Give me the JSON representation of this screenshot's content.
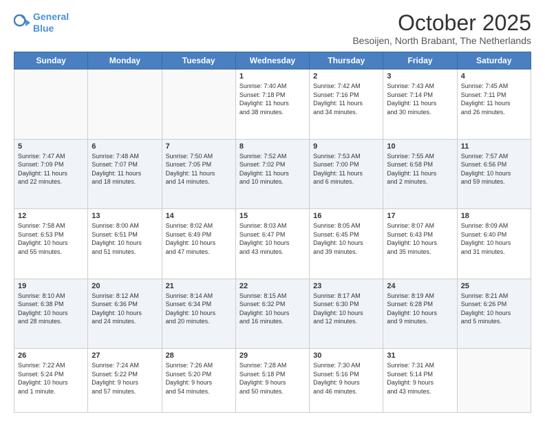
{
  "logo": {
    "line1": "General",
    "line2": "Blue"
  },
  "header": {
    "month": "October 2025",
    "location": "Besoijen, North Brabant, The Netherlands"
  },
  "weekdays": [
    "Sunday",
    "Monday",
    "Tuesday",
    "Wednesday",
    "Thursday",
    "Friday",
    "Saturday"
  ],
  "weeks": [
    [
      {
        "day": "",
        "info": ""
      },
      {
        "day": "",
        "info": ""
      },
      {
        "day": "",
        "info": ""
      },
      {
        "day": "1",
        "info": "Sunrise: 7:40 AM\nSunset: 7:18 PM\nDaylight: 11 hours\nand 38 minutes."
      },
      {
        "day": "2",
        "info": "Sunrise: 7:42 AM\nSunset: 7:16 PM\nDaylight: 11 hours\nand 34 minutes."
      },
      {
        "day": "3",
        "info": "Sunrise: 7:43 AM\nSunset: 7:14 PM\nDaylight: 11 hours\nand 30 minutes."
      },
      {
        "day": "4",
        "info": "Sunrise: 7:45 AM\nSunset: 7:11 PM\nDaylight: 11 hours\nand 26 minutes."
      }
    ],
    [
      {
        "day": "5",
        "info": "Sunrise: 7:47 AM\nSunset: 7:09 PM\nDaylight: 11 hours\nand 22 minutes."
      },
      {
        "day": "6",
        "info": "Sunrise: 7:48 AM\nSunset: 7:07 PM\nDaylight: 11 hours\nand 18 minutes."
      },
      {
        "day": "7",
        "info": "Sunrise: 7:50 AM\nSunset: 7:05 PM\nDaylight: 11 hours\nand 14 minutes."
      },
      {
        "day": "8",
        "info": "Sunrise: 7:52 AM\nSunset: 7:02 PM\nDaylight: 11 hours\nand 10 minutes."
      },
      {
        "day": "9",
        "info": "Sunrise: 7:53 AM\nSunset: 7:00 PM\nDaylight: 11 hours\nand 6 minutes."
      },
      {
        "day": "10",
        "info": "Sunrise: 7:55 AM\nSunset: 6:58 PM\nDaylight: 11 hours\nand 2 minutes."
      },
      {
        "day": "11",
        "info": "Sunrise: 7:57 AM\nSunset: 6:56 PM\nDaylight: 10 hours\nand 59 minutes."
      }
    ],
    [
      {
        "day": "12",
        "info": "Sunrise: 7:58 AM\nSunset: 6:53 PM\nDaylight: 10 hours\nand 55 minutes."
      },
      {
        "day": "13",
        "info": "Sunrise: 8:00 AM\nSunset: 6:51 PM\nDaylight: 10 hours\nand 51 minutes."
      },
      {
        "day": "14",
        "info": "Sunrise: 8:02 AM\nSunset: 6:49 PM\nDaylight: 10 hours\nand 47 minutes."
      },
      {
        "day": "15",
        "info": "Sunrise: 8:03 AM\nSunset: 6:47 PM\nDaylight: 10 hours\nand 43 minutes."
      },
      {
        "day": "16",
        "info": "Sunrise: 8:05 AM\nSunset: 6:45 PM\nDaylight: 10 hours\nand 39 minutes."
      },
      {
        "day": "17",
        "info": "Sunrise: 8:07 AM\nSunset: 6:43 PM\nDaylight: 10 hours\nand 35 minutes."
      },
      {
        "day": "18",
        "info": "Sunrise: 8:09 AM\nSunset: 6:40 PM\nDaylight: 10 hours\nand 31 minutes."
      }
    ],
    [
      {
        "day": "19",
        "info": "Sunrise: 8:10 AM\nSunset: 6:38 PM\nDaylight: 10 hours\nand 28 minutes."
      },
      {
        "day": "20",
        "info": "Sunrise: 8:12 AM\nSunset: 6:36 PM\nDaylight: 10 hours\nand 24 minutes."
      },
      {
        "day": "21",
        "info": "Sunrise: 8:14 AM\nSunset: 6:34 PM\nDaylight: 10 hours\nand 20 minutes."
      },
      {
        "day": "22",
        "info": "Sunrise: 8:15 AM\nSunset: 6:32 PM\nDaylight: 10 hours\nand 16 minutes."
      },
      {
        "day": "23",
        "info": "Sunrise: 8:17 AM\nSunset: 6:30 PM\nDaylight: 10 hours\nand 12 minutes."
      },
      {
        "day": "24",
        "info": "Sunrise: 8:19 AM\nSunset: 6:28 PM\nDaylight: 10 hours\nand 9 minutes."
      },
      {
        "day": "25",
        "info": "Sunrise: 8:21 AM\nSunset: 6:26 PM\nDaylight: 10 hours\nand 5 minutes."
      }
    ],
    [
      {
        "day": "26",
        "info": "Sunrise: 7:22 AM\nSunset: 5:24 PM\nDaylight: 10 hours\nand 1 minute."
      },
      {
        "day": "27",
        "info": "Sunrise: 7:24 AM\nSunset: 5:22 PM\nDaylight: 9 hours\nand 57 minutes."
      },
      {
        "day": "28",
        "info": "Sunrise: 7:26 AM\nSunset: 5:20 PM\nDaylight: 9 hours\nand 54 minutes."
      },
      {
        "day": "29",
        "info": "Sunrise: 7:28 AM\nSunset: 5:18 PM\nDaylight: 9 hours\nand 50 minutes."
      },
      {
        "day": "30",
        "info": "Sunrise: 7:30 AM\nSunset: 5:16 PM\nDaylight: 9 hours\nand 46 minutes."
      },
      {
        "day": "31",
        "info": "Sunrise: 7:31 AM\nSunset: 5:14 PM\nDaylight: 9 hours\nand 43 minutes."
      },
      {
        "day": "",
        "info": ""
      }
    ]
  ]
}
